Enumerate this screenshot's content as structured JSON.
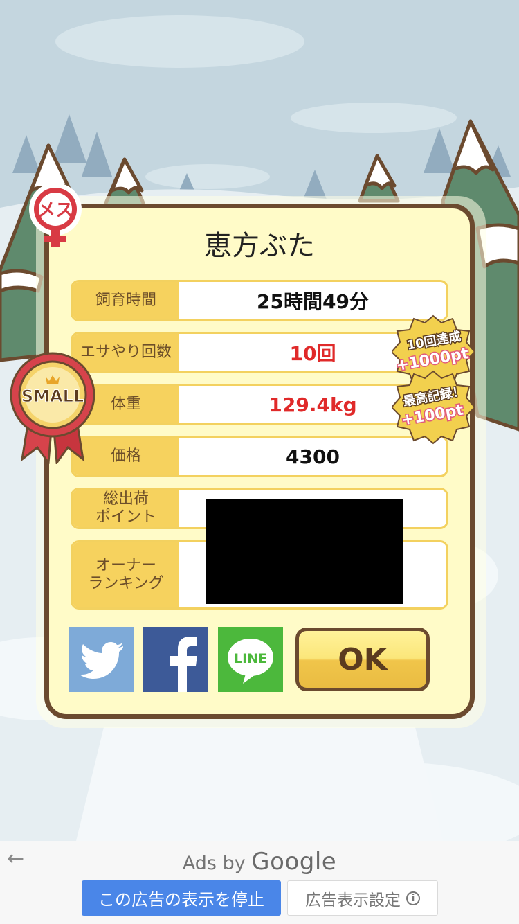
{
  "pig": {
    "name": "恵方ぶた"
  },
  "gender_badge": {
    "text": "メス"
  },
  "size_badge": {
    "text": "SMALL"
  },
  "stats": [
    {
      "label": "飼育時間",
      "value": "25時間49分",
      "highlight": false
    },
    {
      "label": "エサやり回数",
      "value": "10回",
      "highlight": true
    },
    {
      "label": "体重",
      "value": "129.4kg",
      "highlight": true
    },
    {
      "label": "価格",
      "value": "4300",
      "highlight": false
    },
    {
      "label": "総出荷\nポイント",
      "value": "",
      "highlight": false
    },
    {
      "label": "オーナー\nランキング",
      "value": "",
      "highlight": false
    }
  ],
  "bonuses": [
    {
      "title": "10回達成",
      "points": "+1000pt"
    },
    {
      "title": "最高記録！",
      "points": "+100pt"
    }
  ],
  "share": {
    "line_label": "LINE"
  },
  "ok_label": "OK",
  "ads": {
    "ads_by": "Ads by",
    "google": "Google",
    "stop_label": "この広告の表示を停止",
    "settings_label": "広告表示設定",
    "info_icon": "i"
  },
  "colors": {
    "accent_yellow": "#f6d25e",
    "highlight_red": "#e02a2a",
    "frame_brown": "#6b4a2f",
    "ad_blue": "#4a86e8"
  }
}
